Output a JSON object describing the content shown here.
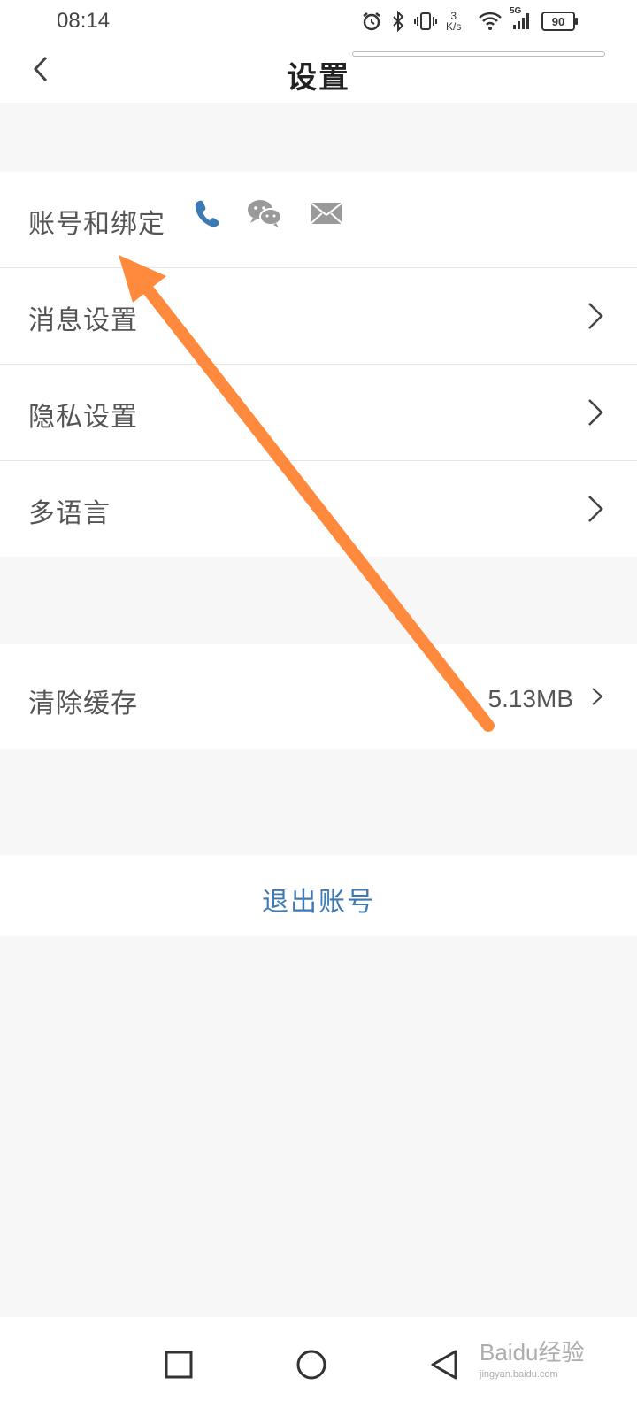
{
  "status_bar": {
    "time": "08:14",
    "net_speed_value": "3",
    "net_speed_unit": "K/s",
    "network": "5G",
    "battery": "90",
    "icons": [
      "alarm-icon",
      "bluetooth-icon",
      "vibrate-icon",
      "wifi-icon",
      "signal-icon",
      "battery-icon"
    ]
  },
  "header": {
    "title": "设置",
    "back_icon": "chevron-left-icon"
  },
  "account_section": {
    "items": [
      {
        "label": "账号和绑定",
        "icons": [
          "phone-icon",
          "wechat-icon",
          "mail-icon"
        ]
      },
      {
        "label": "消息设置"
      },
      {
        "label": "隐私设置"
      },
      {
        "label": "多语言"
      }
    ]
  },
  "cache_section": {
    "label": "清除缓存",
    "value": "5.13MB"
  },
  "logout": {
    "label": "退出账号"
  },
  "system_nav": {
    "buttons": [
      "recents-square-icon",
      "home-circle-icon",
      "back-triangle-icon"
    ]
  },
  "watermark": {
    "brand": "Baidu经验",
    "url": "jingyan.baidu.com"
  },
  "annotation": {
    "type": "arrow",
    "color": "#ff8a3d"
  },
  "colors": {
    "accent": "#3d7ab3",
    "background": "#f7f7f7",
    "phone_icon": "#3d7ab3",
    "social_icon": "#9a9a9a"
  }
}
